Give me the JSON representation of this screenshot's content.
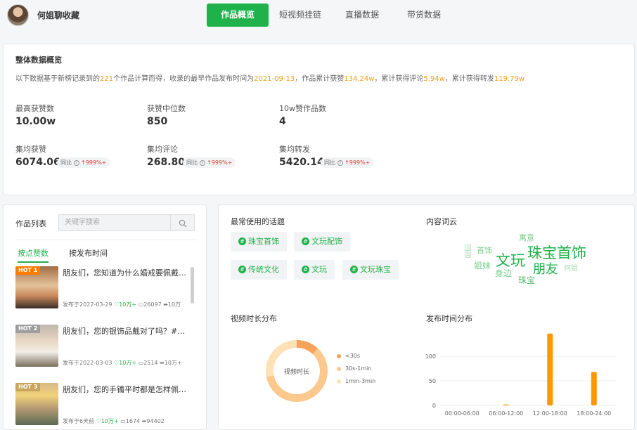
{
  "header": {
    "account_name": "何姐聊收藏",
    "tabs": [
      {
        "label": "作品概览",
        "active": true
      },
      {
        "label": "短视频挂链",
        "active": false
      },
      {
        "label": "直播数据",
        "active": false
      },
      {
        "label": "带货数据",
        "active": false
      }
    ]
  },
  "overview": {
    "title": "整体数据概览",
    "desc": {
      "p1": "以下数据基于新榜记录到的",
      "works_count": "221",
      "p2": "个作品计算而得，收录的最早作品发布时间为",
      "earliest_date": "2021-09-13",
      "p3": "，作品累计获赞",
      "total_likes": "134.24w",
      "p4": "，累计获得评论",
      "total_comments": "5.94w",
      "p5": "，累计获得转发",
      "total_shares": "119.79w"
    },
    "metrics": [
      {
        "label": "最高获赞数",
        "value": "10.00w"
      },
      {
        "label": "获赞中位数",
        "value": "850"
      },
      {
        "label": "10w赞作品数",
        "value": "4"
      },
      {
        "label": "集均获赞",
        "value": "6074.06",
        "yoy_label": "同比",
        "yoy_value": "999%+"
      },
      {
        "label": "集均评论",
        "value": "268.80",
        "yoy_label": "同比",
        "yoy_value": "999%+"
      },
      {
        "label": "集均转发",
        "value": "5420.14",
        "yoy_label": "同比",
        "yoy_value": "999%+"
      }
    ]
  },
  "works": {
    "title": "作品列表",
    "search_placeholder": "关键字搜索",
    "sort_tabs": [
      "按点赞数",
      "按发布时间"
    ],
    "items": [
      {
        "hot": "HOT 1",
        "text": "朋友们，您知道为什么婚戒要佩戴在...",
        "date": "发布于2022-03-29",
        "likes": "10万+",
        "comments": "26097",
        "shares": "10万"
      },
      {
        "hot": "HOT 2",
        "text": "朋友们，您的银饰品戴对了吗？#文...",
        "date": "发布于2022-03-03",
        "likes": "10万+",
        "comments": "2514",
        "shares": "10万+"
      },
      {
        "hot": "HOT 3",
        "text": "朋友们，您的手镯平时都是怎样佩戴...",
        "date": "发布于6天前",
        "likes": "10万+",
        "comments": "1674",
        "shares": "94402"
      }
    ]
  },
  "topics": {
    "title": "最常使用的话题",
    "items": [
      "珠宝首饰",
      "文玩配饰",
      "传统文化",
      "文玩",
      "文玩珠宝"
    ]
  },
  "wordcloud": {
    "title": "内容词云",
    "words": [
      "珠宝首饰",
      "文玩",
      "朋友",
      "寓意",
      "首饰",
      "姐妹",
      "身边",
      "珠宝",
      "何姐",
      "回顾"
    ]
  },
  "duration": {
    "title": "视频时长分布",
    "center_label": "视频时长",
    "chart_data": {
      "type": "pie",
      "categories": [
        "<30s",
        "30s-1min",
        "1min-3min"
      ],
      "values": [
        12,
        60,
        28
      ],
      "colors": [
        "#f7a35c",
        "#fbc88d",
        "#fde2b8"
      ]
    }
  },
  "publish_time": {
    "title": "发布时间分布",
    "chart_data": {
      "type": "bar",
      "categories": [
        "00:00-06:00",
        "06:00-12:00",
        "12:00-18:00",
        "18:00-24:00"
      ],
      "values": [
        0,
        2,
        146,
        68
      ],
      "ylim": [
        0,
        150
      ],
      "yticks": [
        "0",
        "50",
        "100"
      ],
      "color": "#ff9800"
    }
  }
}
